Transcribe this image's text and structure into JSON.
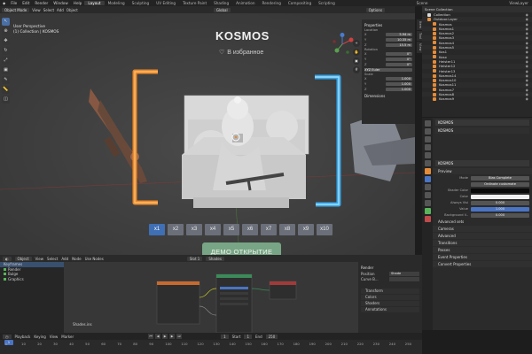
{
  "topbar": {
    "menus": [
      "File",
      "Edit",
      "Render",
      "Window",
      "Help"
    ],
    "workspaces": [
      "Layout",
      "Modeling",
      "Sculpting",
      "UV Editing",
      "Texture Paint",
      "Shading",
      "Animation",
      "Rendering",
      "Compositing",
      "Scripting"
    ],
    "active_workspace": "Layout",
    "scene": "Scene",
    "view_layer": "ViewLayer"
  },
  "viewport_header": {
    "mode": "Object Mode",
    "menus": [
      "View",
      "Select",
      "Add",
      "Object"
    ],
    "transform": "Global",
    "options": "Options"
  },
  "viewport": {
    "info_line1": "User Perspective",
    "info_line2": "(1) Collection | KOSMOS",
    "title": "KOSMOS",
    "favorite_text": "В избранное",
    "multipliers": [
      "x1",
      "x2",
      "x3",
      "x4",
      "x5",
      "x6",
      "x7",
      "x8",
      "x9",
      "x10"
    ],
    "selected_multiplier": "x1",
    "demo_button": "ДЕМО ОТКРЫТИЕ"
  },
  "n_panel": {
    "properties_title": "Properties",
    "location_label": "Location",
    "location": [
      "5.94 m",
      "10.35 m",
      "15.5 m"
    ],
    "rotation_label": "Rotation",
    "rotation": [
      "0°",
      "0°",
      "0°"
    ],
    "mode_label": "XYZ Euler",
    "scale_label": "Scale",
    "scale": [
      "1.000",
      "1.000",
      "1.000"
    ],
    "dimensions_label": "Dimensions",
    "tabs": [
      "Item",
      "Tool",
      "View"
    ]
  },
  "outliner": {
    "title": "Scene Collection",
    "items": [
      "Collection",
      "Outdoor.Layer",
      "Kosmos",
      "Kosmos1",
      "Kosmos2",
      "Kosmos3",
      "Kosmos4",
      "Kosmos5",
      "Kos1",
      "Kosx",
      "Heister11",
      "Heister12",
      "Heister13",
      "Kosmos14",
      "Kosmos10",
      "Kosmos11",
      "Kosmos7",
      "Kosmos8",
      "Kosmos9"
    ]
  },
  "properties": {
    "object_name": "KOSMOS",
    "material": "KOSMOS",
    "material_slot": "KOSMOS",
    "material_dup": "KOSMOS",
    "preview_label": "Preview",
    "mode_key": "Mode",
    "mode_val": "Bias Complete",
    "blend": "Ordinate customate",
    "shader_color_key": "Shader Color",
    "color_key": "Color",
    "always_vis_key": "Always Visi",
    "always_vis_val": "0.000",
    "value_key": "Value",
    "value_val": "1.000",
    "background_key": "Background li..",
    "background_val": "0.000",
    "advanced_sets": "Advanced sets",
    "sections": [
      "Cameras",
      "Advanced",
      "Transitions",
      "Passes",
      "Event Properties",
      "Convert Properties"
    ]
  },
  "node_header": {
    "mode": "Object",
    "menus": [
      "View",
      "Select",
      "Add",
      "Node"
    ],
    "use_nodes": "Use Nodes",
    "slot": "Slot 1",
    "material": "Shades"
  },
  "node_left": {
    "rows": [
      "Keyframes",
      "Render",
      "Bulge",
      "Graphics"
    ]
  },
  "node_editor": {
    "label": "Shades.ins"
  },
  "node_side": {
    "section": "Render",
    "position_key": "Position",
    "position_val": "Shade",
    "curve_key": "Curve B...",
    "transform_sub": "Transform",
    "subs": [
      "Colors",
      "Shaders",
      "Annotations"
    ]
  },
  "timeline": {
    "playback": "Playback",
    "keying": "Keying",
    "view": "View",
    "marker": "Marker",
    "current_frame": "1",
    "start_label": "Start",
    "start": "1",
    "end_label": "End",
    "end": "250",
    "ticks": [
      "0",
      "10",
      "20",
      "30",
      "40",
      "50",
      "60",
      "70",
      "80",
      "90",
      "100",
      "110",
      "120",
      "130",
      "140",
      "150",
      "160",
      "170",
      "180",
      "190",
      "200",
      "210",
      "220",
      "230",
      "240",
      "250"
    ]
  },
  "colors": {
    "accent_blue": "#3f6fb5",
    "demo_green": "#78a585",
    "frame_orange": "#e8892e",
    "frame_blue": "#3aa6e8"
  }
}
